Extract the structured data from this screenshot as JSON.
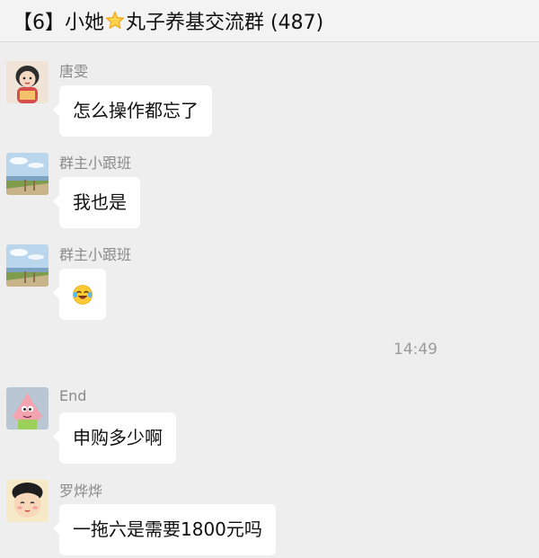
{
  "header": {
    "title_prefix": "【6】小她",
    "title_suffix": "丸子养基交流群 (487)",
    "star_icon": "star-icon"
  },
  "messages": [
    {
      "sender": "唐雯",
      "text": "怎么操作都忘了",
      "avatar_icon": "cartoon-girl-avatar"
    },
    {
      "sender": "群主小跟班",
      "text": "我也是",
      "avatar_icon": "beach-landscape-avatar"
    },
    {
      "sender": "群主小跟班",
      "text": "",
      "emoji_icon": "laughing-tears-emoji",
      "avatar_icon": "beach-landscape-avatar"
    },
    {
      "sender": "End",
      "text": "申购多少啊",
      "avatar_icon": "patrick-star-avatar"
    },
    {
      "sender": "罗烨烨",
      "text": "一拖六是需要1800元吗",
      "avatar_icon": "cartoon-face-avatar"
    }
  ],
  "timestamp": "14:49",
  "colors": {
    "background": "#eeeeee",
    "bubble": "#ffffff",
    "sender_text": "#8a8a8a"
  }
}
